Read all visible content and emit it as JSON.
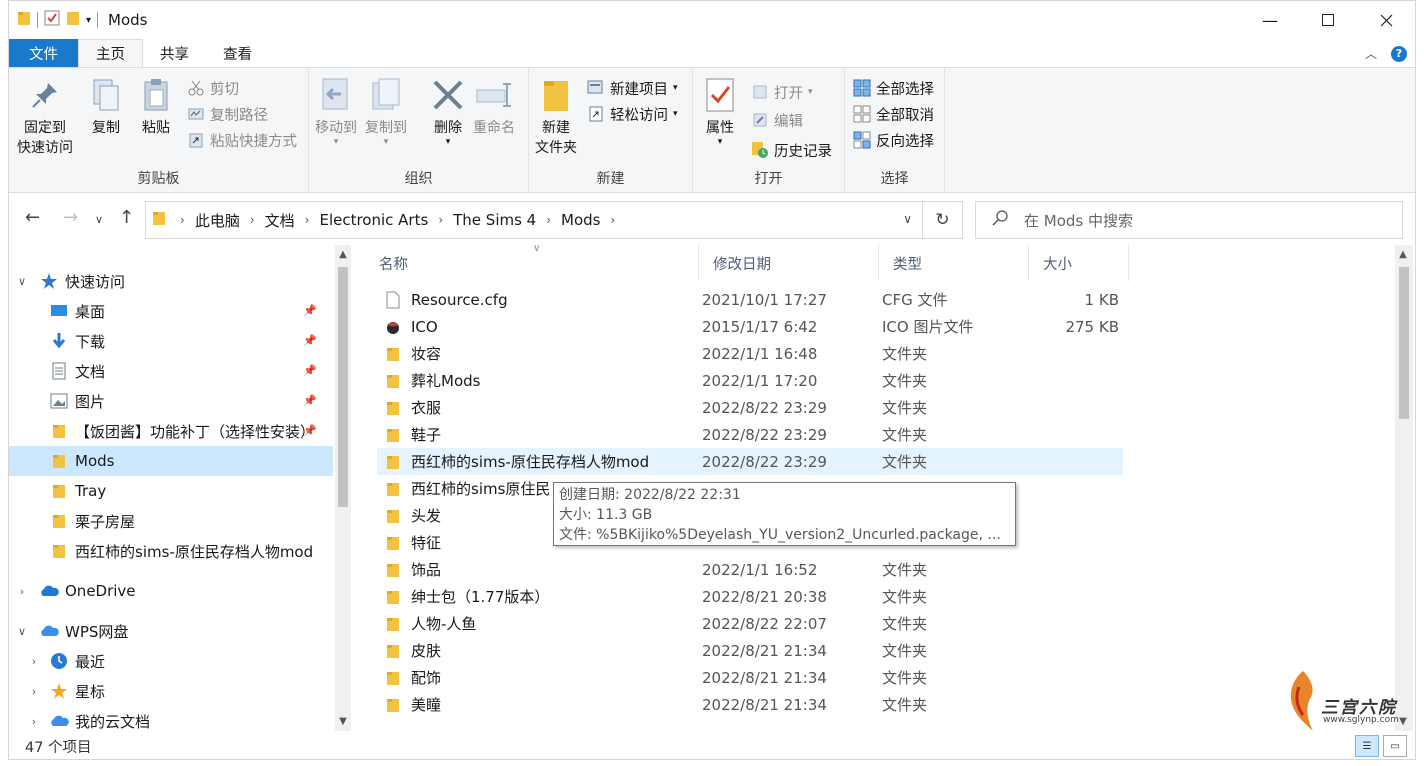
{
  "window": {
    "title": "Mods",
    "controls": [
      "minimize-icon",
      "maximize-icon",
      "close-icon"
    ]
  },
  "tabs": [
    {
      "label": "文件"
    },
    {
      "label": "主页"
    },
    {
      "label": "共享"
    },
    {
      "label": "查看"
    }
  ],
  "ribbon": {
    "clipboard": {
      "label": "剪贴板",
      "pin": "固定到",
      "pin2": "快速访问",
      "copy": "复制",
      "paste": "粘贴",
      "cut": "剪切",
      "copy_path": "复制路径",
      "paste_shortcut": "粘贴快捷方式"
    },
    "organize": {
      "label": "组织",
      "move_to": "移动到",
      "copy_to": "复制到",
      "delete": "删除",
      "rename": "重命名"
    },
    "new": {
      "label": "新建",
      "new_folder": "新建",
      "new_folder2": "文件夹",
      "new_item": "新建项目",
      "easy_access": "轻松访问"
    },
    "open": {
      "label": "打开",
      "properties": "属性",
      "open": "打开",
      "edit": "编辑",
      "history": "历史记录"
    },
    "select": {
      "label": "选择",
      "select_all": "全部选择",
      "select_none": "全部取消",
      "invert": "反向选择"
    }
  },
  "address": {
    "breadcrumb": [
      "此电脑",
      "文档",
      "Electronic Arts",
      "The Sims 4",
      "Mods"
    ],
    "search_placeholder": "在 Mods 中搜索"
  },
  "nav": {
    "quick_access": "快速访问",
    "items": [
      {
        "label": "桌面",
        "icon": "desktop-icon",
        "pinned": true
      },
      {
        "label": "下载",
        "icon": "download-icon",
        "pinned": true
      },
      {
        "label": "文档",
        "icon": "document-icon",
        "pinned": true
      },
      {
        "label": "图片",
        "icon": "picture-icon",
        "pinned": true
      },
      {
        "label": "【饭团酱】功能补丁（选择性安装）",
        "icon": "folder-icon",
        "pinned": true
      },
      {
        "label": "Mods",
        "icon": "folder-icon",
        "selected": true
      },
      {
        "label": "Tray",
        "icon": "folder-icon"
      },
      {
        "label": "栗子房屋",
        "icon": "folder-icon"
      },
      {
        "label": "西红柿的sims-原住民存档人物mod",
        "icon": "folder-icon"
      }
    ],
    "onedrive": "OneDrive",
    "wps": "WPS网盘",
    "wps_items": [
      {
        "label": "最近",
        "icon": "clock-icon"
      },
      {
        "label": "星标",
        "icon": "star-icon"
      },
      {
        "label": "我的云文档",
        "icon": "cloud-icon"
      }
    ]
  },
  "columns": {
    "name": "名称",
    "date": "修改日期",
    "type": "类型",
    "size": "大小"
  },
  "files": [
    {
      "name": "Resource.cfg",
      "date": "2021/10/1 17:27",
      "type": "CFG 文件",
      "size": "1 KB",
      "icon": "file-icon"
    },
    {
      "name": "ICO",
      "date": "2015/1/17 6:42",
      "type": "ICO 图片文件",
      "size": "275 KB",
      "icon": "ico-file-icon"
    },
    {
      "name": "妆容",
      "date": "2022/1/1 16:48",
      "type": "文件夹",
      "size": "",
      "icon": "folder-icon"
    },
    {
      "name": "葬礼Mods",
      "date": "2022/1/1 17:20",
      "type": "文件夹",
      "size": "",
      "icon": "folder-icon"
    },
    {
      "name": "衣服",
      "date": "2022/8/22 23:29",
      "type": "文件夹",
      "size": "",
      "icon": "folder-icon"
    },
    {
      "name": "鞋子",
      "date": "2022/8/22 23:29",
      "type": "文件夹",
      "size": "",
      "icon": "folder-icon"
    },
    {
      "name": "西红柿的sims-原住民存档人物mod",
      "date": "2022/8/22 23:29",
      "type": "文件夹",
      "size": "",
      "icon": "folder-icon",
      "hover": true
    },
    {
      "name": "西红柿的sims原住民",
      "date": "",
      "type": "",
      "size": "",
      "icon": "folder-icon"
    },
    {
      "name": "头发",
      "date": "",
      "type": "",
      "size": "",
      "icon": "folder-icon"
    },
    {
      "name": "特征",
      "date": "",
      "type": "",
      "size": "",
      "icon": "folder-icon"
    },
    {
      "name": "饰品",
      "date": "2022/1/1 16:52",
      "type": "文件夹",
      "size": "",
      "icon": "folder-icon"
    },
    {
      "name": "绅士包（1.77版本）",
      "date": "2022/8/21 20:38",
      "type": "文件夹",
      "size": "",
      "icon": "folder-icon"
    },
    {
      "name": "人物-人鱼",
      "date": "2022/8/22 22:07",
      "type": "文件夹",
      "size": "",
      "icon": "folder-icon"
    },
    {
      "name": "皮肤",
      "date": "2022/8/21 21:34",
      "type": "文件夹",
      "size": "",
      "icon": "folder-icon"
    },
    {
      "name": "配饰",
      "date": "2022/8/21 21:34",
      "type": "文件夹",
      "size": "",
      "icon": "folder-icon"
    },
    {
      "name": "美瞳",
      "date": "2022/8/21 21:34",
      "type": "文件夹",
      "size": "",
      "icon": "folder-icon"
    }
  ],
  "tooltip": {
    "line1": "创建日期: 2022/8/22 22:31",
    "line2": "大小: 11.3 GB",
    "line3": "文件: %5BKijiko%5Deyelash_YU_version2_Uncurled.package, ..."
  },
  "status": {
    "count": "47 个项目"
  },
  "watermark": {
    "text": "三宫六院",
    "url": "www.sglynp.com"
  }
}
